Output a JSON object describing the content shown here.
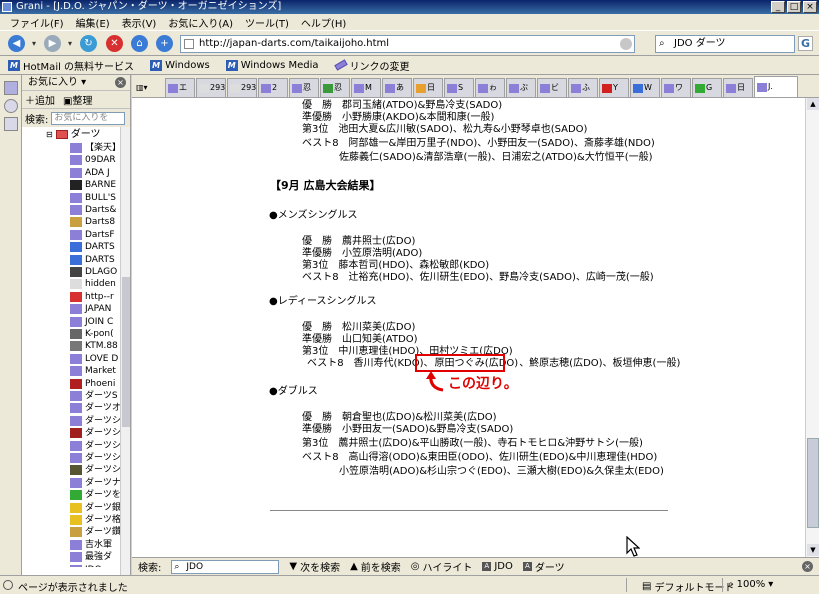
{
  "window": {
    "title": "Grani - [J.D.O. ジャパン・ダーツ・オーガニゼイションズ]",
    "min": "_",
    "max": "□",
    "close": "×"
  },
  "menu": [
    "ファイル(F)",
    "編集(E)",
    "表示(V)",
    "お気に入り(A)",
    "ツール(T)",
    "ヘルプ(H)"
  ],
  "address": {
    "url": "http://japan-darts.com/taikaijoho.html",
    "search_value": "JDO ダーツ",
    "google": "G"
  },
  "links": [
    {
      "label": "HotMail の無料サービス",
      "icon": "msn-icon"
    },
    {
      "label": "Windows",
      "icon": "msn-icon"
    },
    {
      "label": "Windows Media",
      "icon": "msn-icon"
    },
    {
      "label": "リンクの変更",
      "icon": "pencil-icon"
    }
  ],
  "sidebar": {
    "header": "お気に入り ▾",
    "add": "追加",
    "organize": "整理",
    "search_label": "検索:",
    "search_placeholder": "お気に入りを",
    "folder": "ダーツ",
    "items": [
      {
        "label": "【楽天】",
        "icon": "pencil-icon"
      },
      {
        "label": "09DAR",
        "icon": "pencil-icon"
      },
      {
        "label": "ADA J",
        "icon": "pencil-icon"
      },
      {
        "label": "BARNE",
        "icon": "skull-icon"
      },
      {
        "label": "BULL'S",
        "icon": "pencil-icon"
      },
      {
        "label": "Darts&",
        "icon": "pencil-icon"
      },
      {
        "label": "Darts8",
        "icon": "darts-icon"
      },
      {
        "label": "DartsF",
        "icon": "pencil-icon"
      },
      {
        "label": "DARTS",
        "icon": "swirl-icon"
      },
      {
        "label": "DARTS",
        "icon": "swirl-icon"
      },
      {
        "label": "DLAGO",
        "icon": "game-icon"
      },
      {
        "label": "hidden",
        "icon": "page-icon"
      },
      {
        "label": "http--r",
        "icon": "dbl-icon"
      },
      {
        "label": "JAPAN",
        "icon": "pencil-icon"
      },
      {
        "label": "JOIN C",
        "icon": "pencil-icon"
      },
      {
        "label": "K-pon(",
        "icon": "pen-icon"
      },
      {
        "label": "KTM.88",
        "icon": "gear-icon"
      },
      {
        "label": "LOVE D",
        "icon": "pencil-icon"
      },
      {
        "label": "Market",
        "icon": "pencil-icon"
      },
      {
        "label": "Phoeni",
        "icon": "phoenix-icon"
      },
      {
        "label": "ダーツS",
        "icon": "pencil-icon"
      },
      {
        "label": "ダーツオ",
        "icon": "pencil-icon"
      },
      {
        "label": "ダーツシ",
        "icon": "pencil-icon"
      },
      {
        "label": "ダーツシ",
        "icon": "sd-icon"
      },
      {
        "label": "ダーツシ",
        "icon": "pencil-icon"
      },
      {
        "label": "ダーツシ",
        "icon": "pencil-icon"
      },
      {
        "label": "ダーツシ",
        "icon": "face-icon"
      },
      {
        "label": "ダーツナ",
        "icon": "pencil-icon"
      },
      {
        "label": "ダーツを",
        "icon": "g-icon"
      },
      {
        "label": "ダーツ銀",
        "icon": "smile-icon"
      },
      {
        "label": "ダーツ格",
        "icon": "smile-icon"
      },
      {
        "label": "ダーツ鑽",
        "icon": "darts-icon"
      },
      {
        "label": "吉水軍",
        "icon": "pencil-icon"
      },
      {
        "label": "最強ダ",
        "icon": "pencil-icon"
      },
      {
        "label": "JDO",
        "icon": "pencil-icon"
      }
    ]
  },
  "tabs": [
    {
      "label": "エ",
      "icon": "pencil-icon"
    },
    {
      "label": "293",
      "icon": "page-icon"
    },
    {
      "label": "293",
      "icon": "page-icon"
    },
    {
      "label": "2",
      "icon": "pencil-icon"
    },
    {
      "label": "忍",
      "icon": "pencil-icon"
    },
    {
      "label": "忍",
      "icon": "clover-icon"
    },
    {
      "label": "M",
      "icon": "pencil-icon"
    },
    {
      "label": "あ",
      "icon": "pencil-icon"
    },
    {
      "label": "日",
      "icon": "bar-icon"
    },
    {
      "label": "S",
      "icon": "pencil-icon"
    },
    {
      "label": "ゎ",
      "icon": "pencil-icon"
    },
    {
      "label": "ぶ",
      "icon": "pencil-icon"
    },
    {
      "label": "ビ",
      "icon": "pencil-icon"
    },
    {
      "label": "ふ",
      "icon": "pencil-icon"
    },
    {
      "label": "Y",
      "icon": "y-icon"
    },
    {
      "label": "W",
      "icon": "w-icon"
    },
    {
      "label": "ワ",
      "icon": "pencil-icon"
    },
    {
      "label": "G",
      "icon": "g-icon"
    },
    {
      "label": "日",
      "icon": "pencil-icon"
    },
    {
      "label": "J.",
      "icon": "pencil-icon"
    }
  ],
  "content": {
    "prev": {
      "l1": "優　勝　郡司玉緒(ATDO)&野島冷支(SADO)",
      "l2": "準優勝　小野勝康(AKDO)&本間和康(一般)",
      "l3": "第3位　池田大夏&広川敏(SADO)、松九寿&小野琴卓也(SADO)",
      "l4": "ベスト8　阿部雄一&岸田万里子(NDO)、小野田友一(SADO)、斎藤孝雄(NDO)",
      "l5": "佐藤義仁(SADO)&清部浩章(一般)、日浦宏之(ATDO)&大竹恒平(一般)"
    },
    "section_title": "【9月 広島大会結果】",
    "mens": {
      "title": "●メンズシングルス",
      "l1": "優　勝　薦井照士(広DO)",
      "l2": "準優勝　小笠原浩明(ADO)",
      "l3": "第3位　藤本哲司(HDO)、森松敏郎(KDO)",
      "l4": "ベスト8　辻裕充(HDO)、佐川研生(EDO)、野島冷支(SADO)、広崎一茂(一般)"
    },
    "ladies": {
      "title": "●レディースシングルス",
      "l1": "優　勝　松川菜美(広DO)",
      "l2": "準優勝　山口知美(ATDO)",
      "l3": "第3位　中川恵理佳(HDO)、田村ツミエ(広DO)",
      "l4a": "ベスト8　香川寿代(KDO)、",
      "l4b": "原田つぐみ(広DO)",
      "l4c": "、鮗原志穂(広DO)、板垣伸恵(一般)"
    },
    "annotation": "この辺り。",
    "doubles": {
      "title": "●ダブルス",
      "l1": "優　勝　朝倉聖也(広DO)&松川菜美(広DO)",
      "l2": "準優勝　小野田友一(SADO)&野島冷支(SADO)",
      "l3": "第3位　薦井照士(広DO)&平山勝政(一般)、寺石トモヒロ&沖野サトシ(一般)",
      "l4": "ベスト8　高山得溶(ODO)&東田臣(ODO)、佐川研生(EDO)&中川恵理佳(HDO)",
      "l5": "小笠原浩明(ADO)&杉山宗つぐ(EDO)、三瀬大樹(EDO)&久保圭太(EDO)"
    }
  },
  "findbar": {
    "label": "検索:",
    "value": "JDO",
    "next": "次を検索",
    "prev": "前を検索",
    "highlight": "ハイライト",
    "w1": "JDO",
    "w2": "ダーツ"
  },
  "status": {
    "text": "ページが表示されました",
    "mode": "デフォルトモード",
    "zoom": "100%"
  },
  "colors": {
    "annotation": "#e00000",
    "titlebar": "#0a246a"
  }
}
